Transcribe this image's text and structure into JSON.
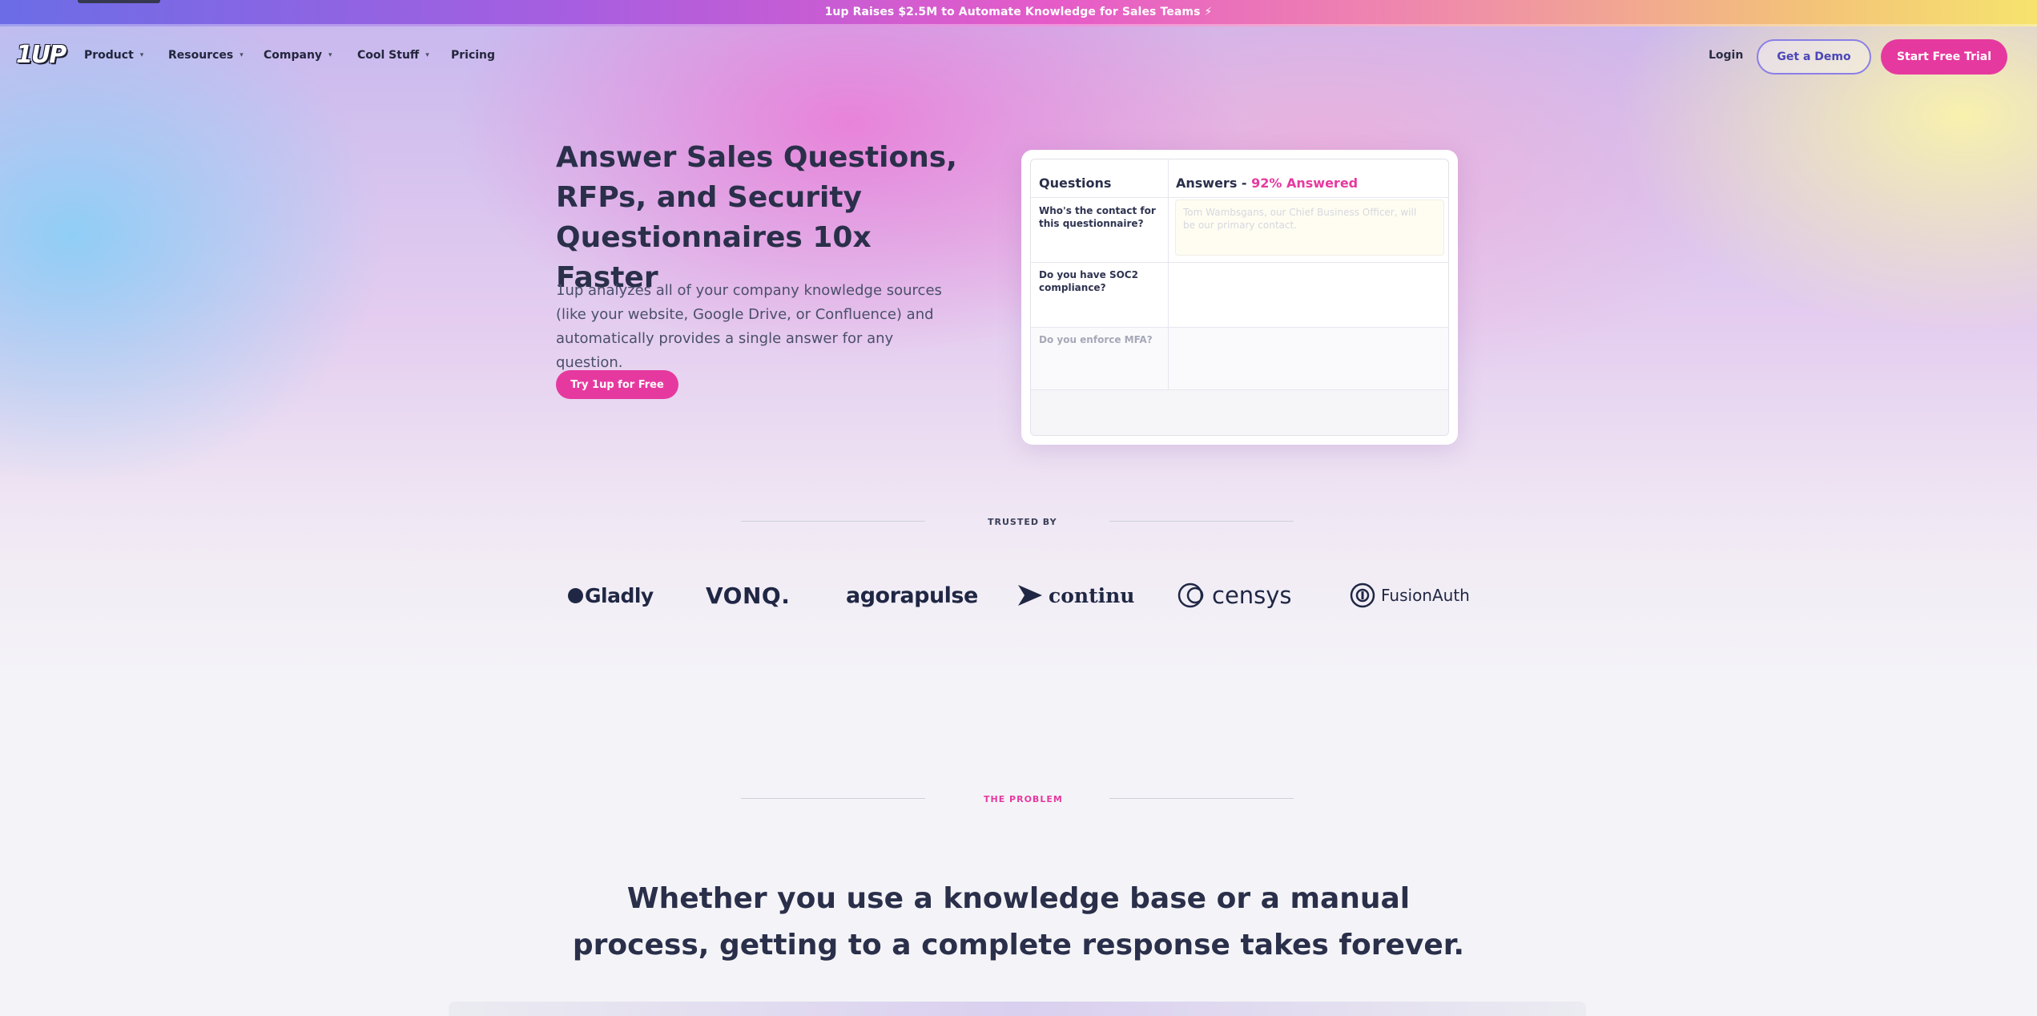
{
  "announcement": {
    "text": "1up Raises $2.5M to Automate Knowledge for Sales Teams ⚡"
  },
  "nav": {
    "logo_text": "1UP",
    "items": [
      {
        "label": "Product",
        "has_menu": true
      },
      {
        "label": "Resources",
        "has_menu": true
      },
      {
        "label": "Company",
        "has_menu": true
      },
      {
        "label": "Cool Stuff",
        "has_menu": true
      },
      {
        "label": "Pricing",
        "has_menu": false
      }
    ],
    "caret": "▾",
    "login": "Login",
    "demo_button": "Get a Demo",
    "trial_button": "Start Free Trial"
  },
  "hero": {
    "title": "Answer Sales Questions, RFPs, and Security Questionnaires 10x Faster",
    "subtitle": "1up analyzes all of your company knowledge sources (like your website, Google Drive, or Confluence) and automatically provides a single answer for any question.",
    "cta": "Try 1up for Free"
  },
  "demo_table": {
    "questions_header": "Questions",
    "answers_header": "Answers - ",
    "answered_pct": "92% Answered",
    "rows": [
      {
        "question": "Who's the contact for this questionnaire?",
        "answer": "Tom Wambsgans, our Chief Business Officer, will be our primary contact."
      },
      {
        "question": "Do you have SOC2 compliance?",
        "answer": ""
      },
      {
        "question": "Do you enforce MFA?",
        "answer": ""
      }
    ]
  },
  "trusted": {
    "label": "TRUSTED BY",
    "logos": [
      "Gladly",
      "VONQ.",
      "agorapulse",
      "continu",
      "censys",
      "FusionAuth"
    ]
  },
  "problem": {
    "eyebrow": "THE PROBLEM",
    "title": "Whether you use a knowledge base or a manual process, getting to a complete response takes forever."
  },
  "colors": {
    "accent_pink": "#e6399f",
    "accent_purple": "#4b46b8",
    "text_dark": "#2a2f4a"
  }
}
